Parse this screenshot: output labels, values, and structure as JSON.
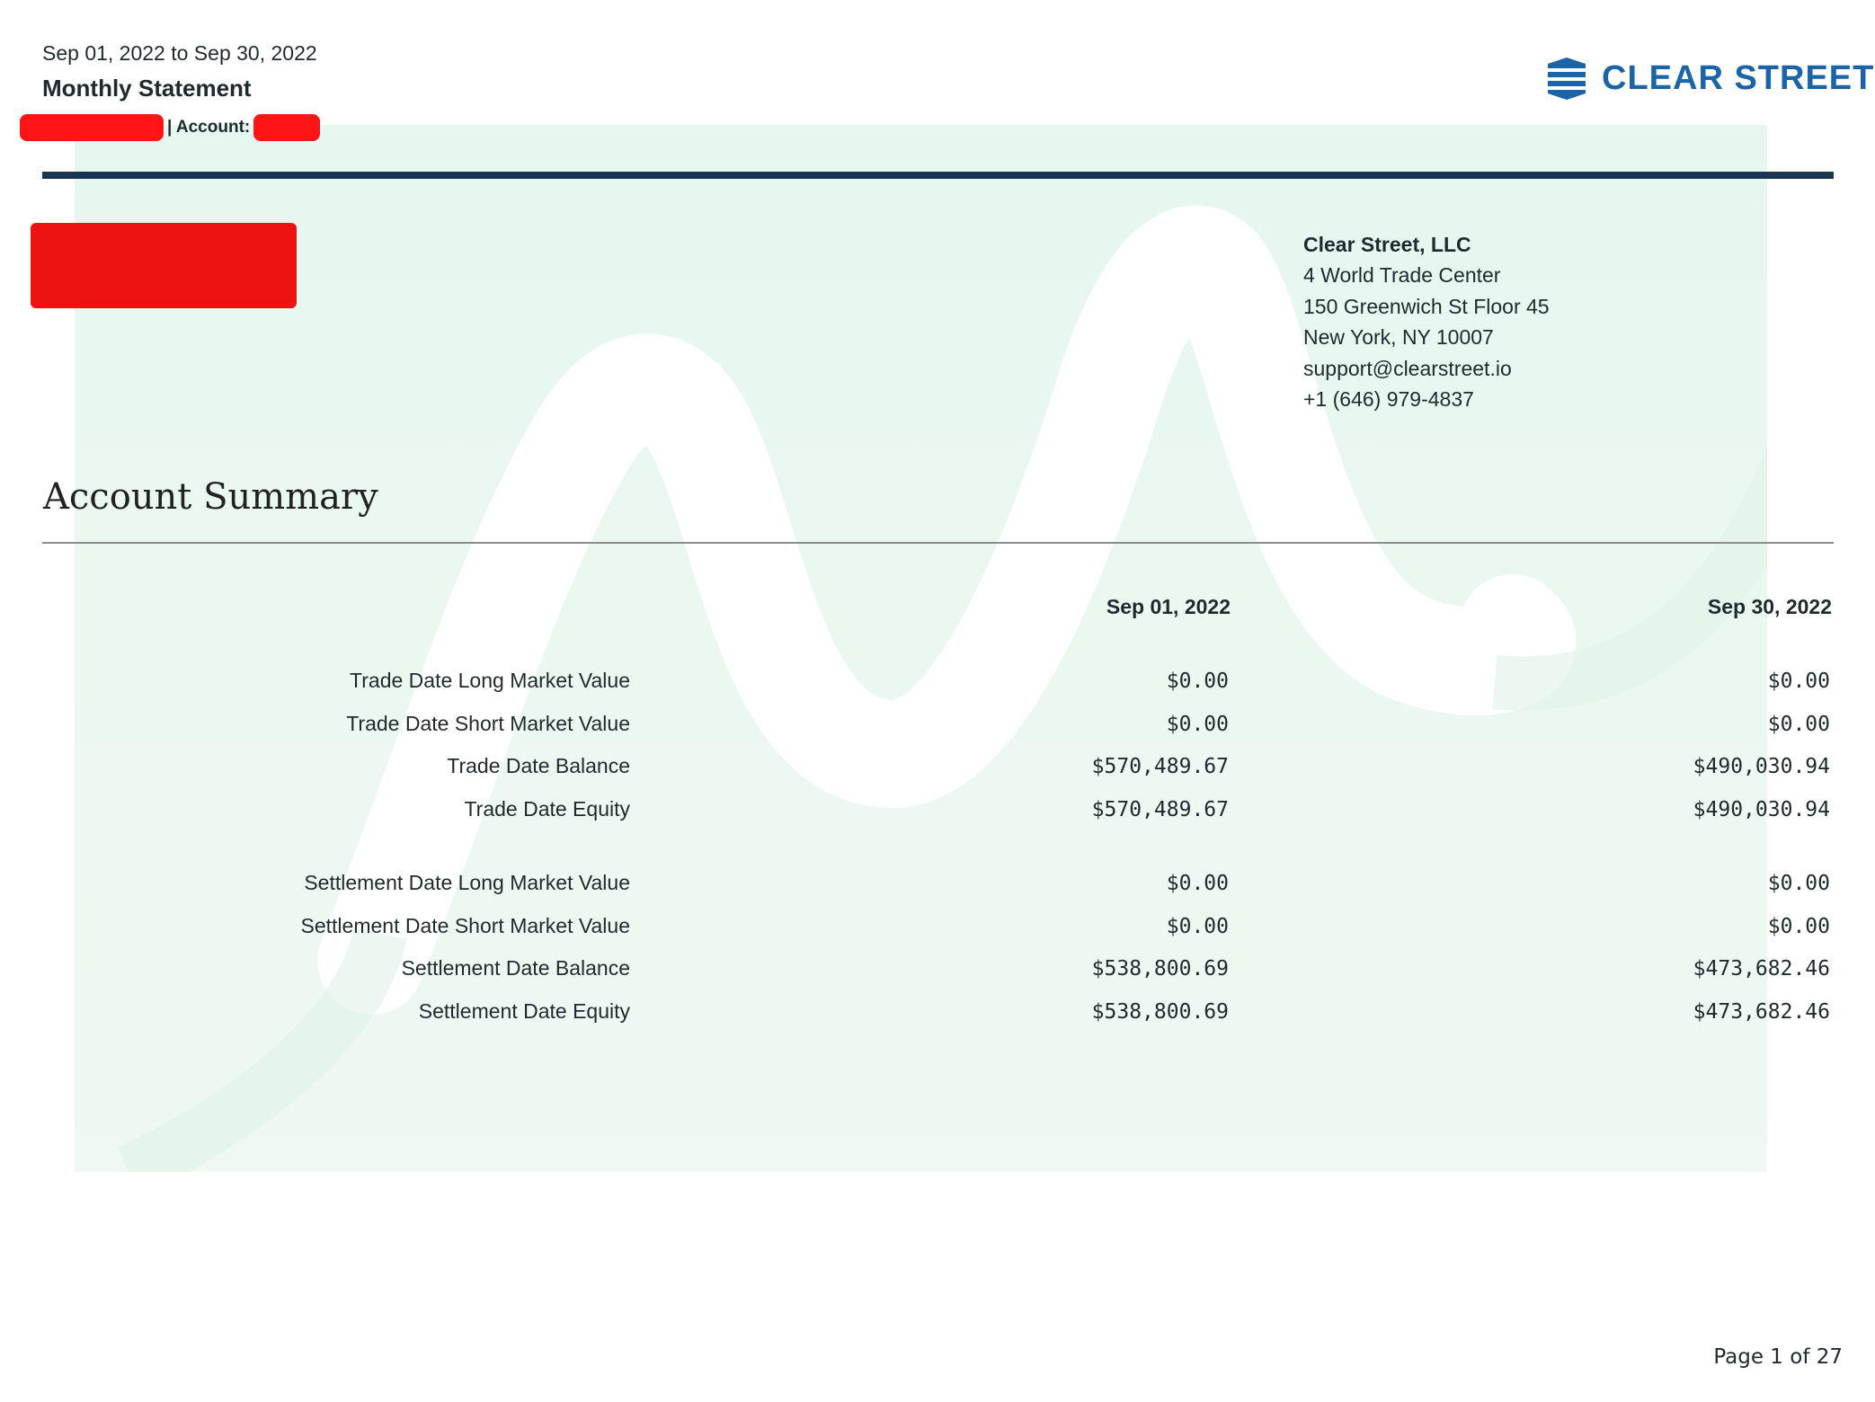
{
  "header": {
    "date_range": "Sep 01, 2022 to Sep 30, 2022",
    "title": "Monthly Statement",
    "account_label": "| Account:"
  },
  "logo": {
    "text": "CLEAR STREET",
    "icon": "clear-street-logo-icon",
    "brand_color": "#1c64a8"
  },
  "address": {
    "company": "Clear Street, LLC",
    "lines": [
      "4 World Trade Center",
      "150 Greenwich St Floor 45",
      "New York, NY 10007",
      "support@clearstreet.io",
      "+1 (646) 979-4837"
    ]
  },
  "summary": {
    "title": "Account Summary",
    "columns": [
      "Sep 01, 2022",
      "Sep 30, 2022"
    ],
    "trade_rows": [
      {
        "label": "Trade Date Long Market Value",
        "start": "$0.00",
        "end": "$0.00"
      },
      {
        "label": "Trade Date Short Market Value",
        "start": "$0.00",
        "end": "$0.00"
      },
      {
        "label": "Trade Date Balance",
        "start": "$570,489.67",
        "end": "$490,030.94"
      },
      {
        "label": "Trade Date Equity",
        "start": "$570,489.67",
        "end": "$490,030.94"
      }
    ],
    "settlement_rows": [
      {
        "label": "Settlement Date Long Market Value",
        "start": "$0.00",
        "end": "$0.00"
      },
      {
        "label": "Settlement Date Short Market Value",
        "start": "$0.00",
        "end": "$0.00"
      },
      {
        "label": "Settlement Date Balance",
        "start": "$538,800.69",
        "end": "$473,682.46"
      },
      {
        "label": "Settlement Date Equity",
        "start": "$538,800.69",
        "end": "$473,682.46"
      }
    ]
  },
  "footer": {
    "page": "Page 1 of 27"
  },
  "colors": {
    "header_rule": "#1a3552",
    "watermark": "#e6f7ef",
    "redaction": "#ff1515"
  }
}
